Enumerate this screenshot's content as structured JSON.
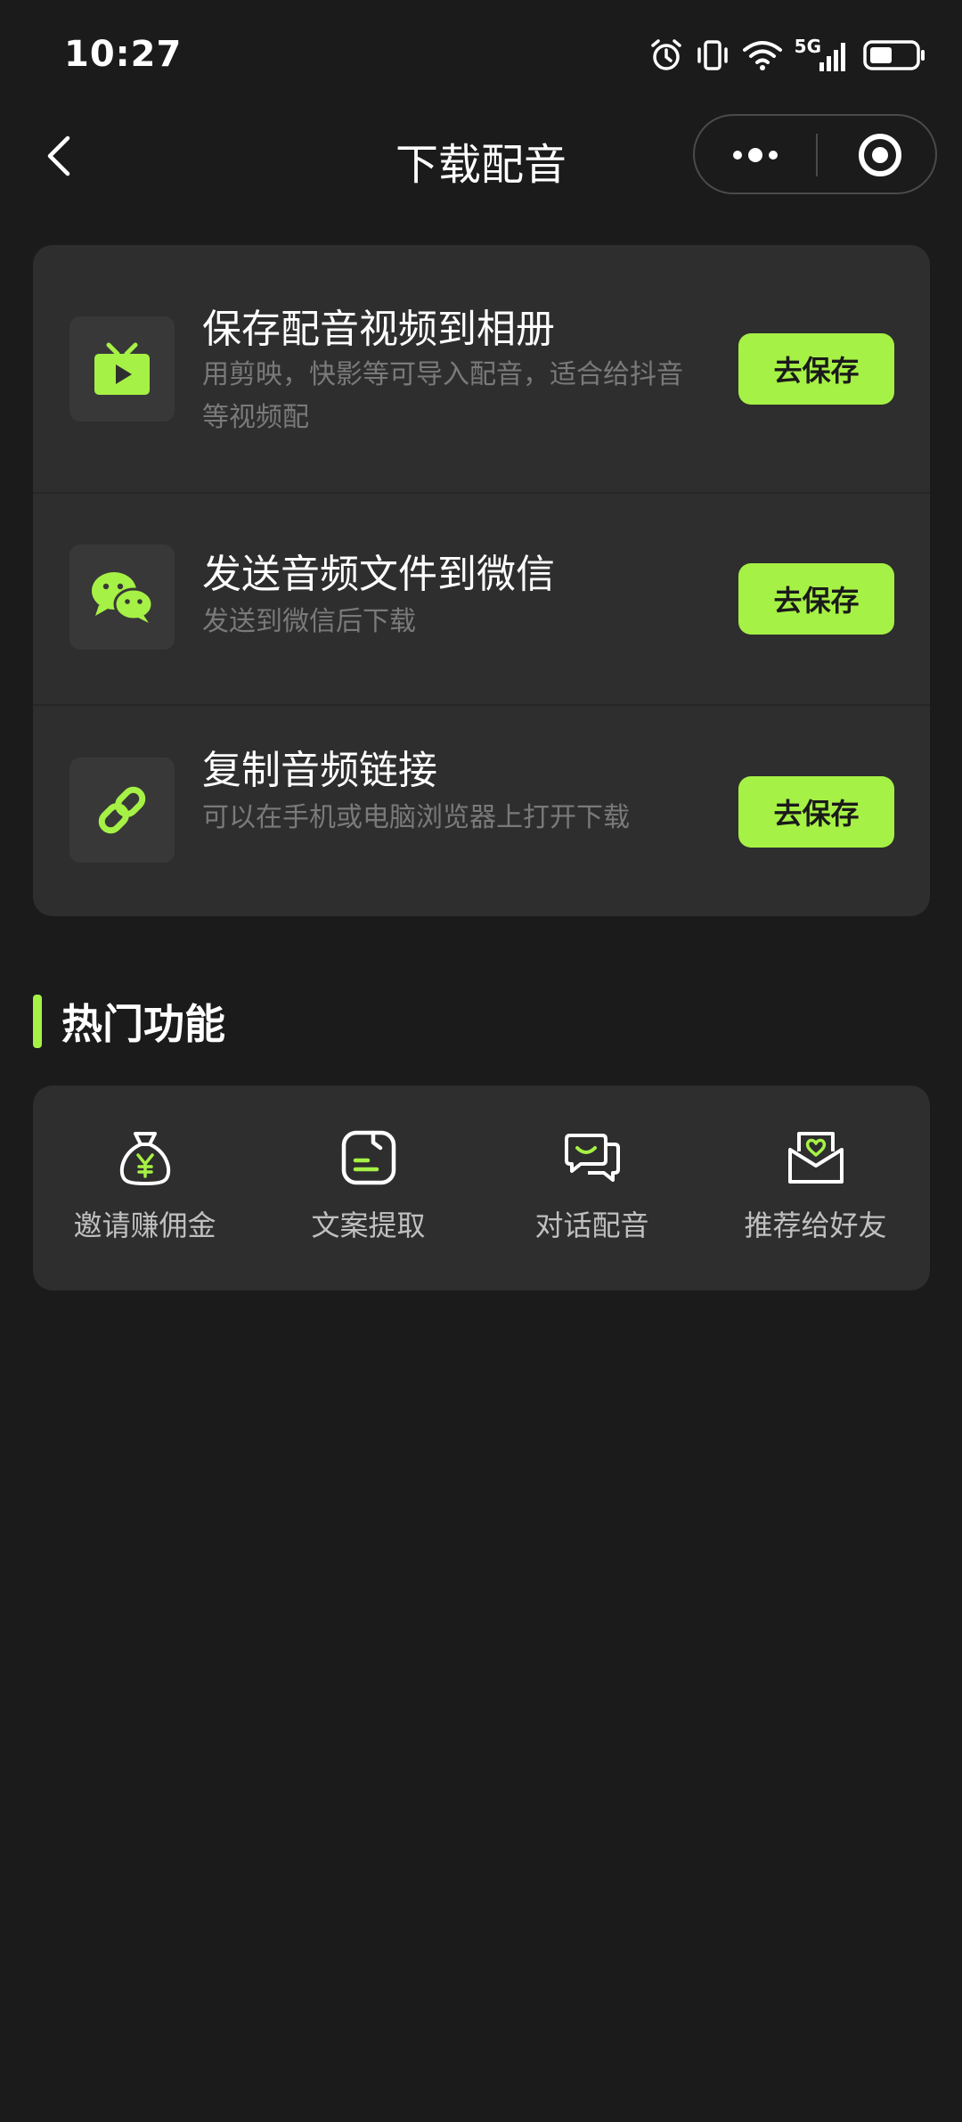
{
  "status_bar": {
    "time": "10:27",
    "network": "5G",
    "icons": [
      "alarm-icon",
      "vibrate-icon",
      "wifi-icon",
      "signal-icon",
      "battery-icon"
    ]
  },
  "nav": {
    "title": "下载配音",
    "back_icon": "chevron-left-icon",
    "more_icon": "more-dots-icon",
    "close_icon": "target-circle-icon"
  },
  "options": [
    {
      "icon": "tv-play-icon",
      "title": "保存配音视频到相册",
      "desc": "用剪映，快影等可导入配音，适合给抖音等视频配",
      "button": "去保存"
    },
    {
      "icon": "wechat-icon",
      "title": "发送音频文件到微信",
      "desc": "发送到微信后下载",
      "button": "去保存"
    },
    {
      "icon": "link-icon",
      "title": "复制音频链接",
      "desc": "可以在手机或电脑浏览器上打开下载",
      "button": "去保存"
    }
  ],
  "hot": {
    "title": "热门功能",
    "items": [
      {
        "label": "邀请赚佣金",
        "icon": "money-bag-icon"
      },
      {
        "label": "文案提取",
        "icon": "text-extract-icon"
      },
      {
        "label": "对话配音",
        "icon": "chat-bubbles-icon"
      },
      {
        "label": "推荐给好友",
        "icon": "heart-envelope-icon"
      }
    ]
  },
  "colors": {
    "accent": "#a6f145",
    "background": "#1b1b1b",
    "card": "#2e2e2e",
    "muted_text": "#7a7a7a"
  }
}
